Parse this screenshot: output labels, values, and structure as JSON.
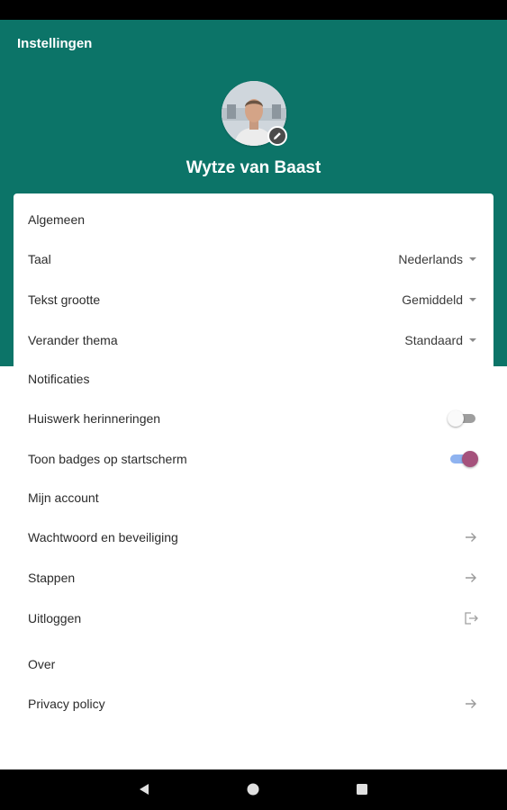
{
  "app": {
    "title": "Instellingen"
  },
  "profile": {
    "name": "Wytze van Baast"
  },
  "sections": {
    "general": "Algemeen",
    "notifications": "Notificaties",
    "account": "Mijn account",
    "about": "Over"
  },
  "settings": {
    "language": {
      "label": "Taal",
      "value": "Nederlands"
    },
    "text_size": {
      "label": "Tekst grootte",
      "value": "Gemiddeld"
    },
    "theme": {
      "label": "Verander thema",
      "value": "Standaard"
    }
  },
  "notifications": {
    "homework": {
      "label": "Huiswerk herinneringen",
      "enabled": false
    },
    "badges": {
      "label": "Toon badges op startscherm",
      "enabled": true
    }
  },
  "account": {
    "password": "Wachtwoord en beveiliging",
    "steps": "Stappen",
    "logout": "Uitloggen"
  },
  "about": {
    "privacy": "Privacy policy"
  },
  "colors": {
    "header": "#0c7468",
    "toggle_on_track": "#8fb3f0",
    "toggle_on_thumb": "#a5527c",
    "toggle_off_track": "#9e9e9e",
    "toggle_off_thumb": "#fafafa"
  },
  "icons": {
    "edit": "pencil-icon",
    "dropdown": "caret-down-icon",
    "navigate": "arrow-right-icon",
    "logout": "logout-icon",
    "back": "back-triangle-icon",
    "home": "home-circle-icon",
    "recents": "recents-square-icon"
  }
}
